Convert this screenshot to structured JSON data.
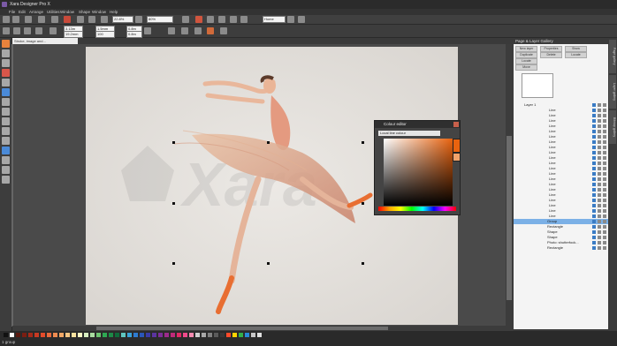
{
  "app": {
    "title": "Xara Designer Pro X"
  },
  "menu": [
    "File",
    "Edit",
    "Arrange",
    "Utilities",
    "Window",
    "Shape",
    "Window",
    "Help"
  ],
  "toolbar": {
    "zoom": "22.8%",
    "zoom_pct": "80%",
    "page_label": "Home",
    "fields": [
      "3.13m",
      "19.2mm",
      "1.5mm",
      "100",
      "0.8m",
      "0.8m"
    ]
  },
  "document": {
    "tab": "Stroke, image and..."
  },
  "watermark": "Xara",
  "colour_editor": {
    "title": "Colour editor",
    "mode": "Local line colour"
  },
  "gallery": {
    "title": "Page & Layer Gallery",
    "buttons": [
      "New layer",
      "Properties",
      "Show",
      "Duplicate",
      "Delete",
      "Locate",
      "Locate",
      "Move"
    ],
    "layer": "Layer 1",
    "rows": [
      "Line",
      "Line",
      "Line",
      "Line",
      "Line",
      "Line",
      "Line",
      "Line",
      "Line",
      "Line",
      "Line",
      "Line",
      "Line",
      "Line",
      "Line",
      "Line",
      "Line",
      "Line",
      "Line",
      "Line",
      "Line",
      "Group",
      "Rectangle",
      "Shape",
      "Shape",
      "Photo: shutterfock...",
      "Rectangle"
    ],
    "selected_index": 21
  },
  "side_tabs": [
    "Page gallery",
    "Layer gallery",
    "Bitmap gallery"
  ],
  "status": {
    "text": "1 group"
  },
  "palette_colors": [
    "#111111",
    "#ffffff",
    "#5a1a10",
    "#7a1e12",
    "#a52a1a",
    "#c83a22",
    "#e34b2a",
    "#e86a3c",
    "#ef8b50",
    "#f2a866",
    "#f6c683",
    "#f9e29f",
    "#fcf6c3",
    "#d8eec0",
    "#a9dca0",
    "#6cc36f",
    "#2ea852",
    "#1d8a47",
    "#0f6b3a",
    "#5fc6c0",
    "#3aa3d8",
    "#2d7bd0",
    "#2a56b8",
    "#3a3aa6",
    "#5b34a0",
    "#7c2e98",
    "#9c2a8c",
    "#c02a7a",
    "#e02a66",
    "#f04a8a",
    "#f58ab0",
    "#cfcfcf",
    "#a8a8a8",
    "#808080",
    "#5a5a5a",
    "#383838",
    "#ff4a2a",
    "#ffd400",
    "#33b04a",
    "#2888d8",
    "#c8c8c8",
    "#e0e0e0"
  ]
}
